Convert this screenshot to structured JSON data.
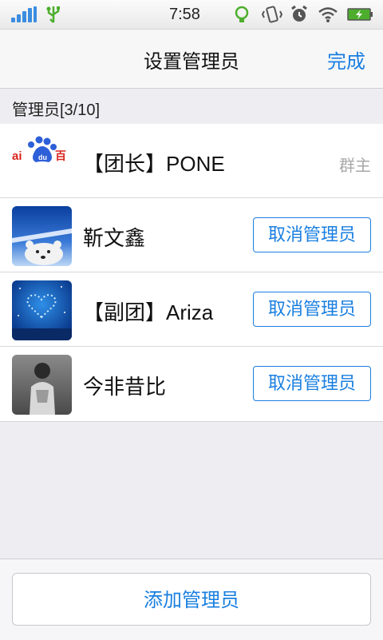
{
  "status_bar": {
    "time": "7:58",
    "icons": [
      "signal-icon",
      "usb-icon",
      "bulb-icon",
      "vibrate-icon",
      "alarm-icon",
      "wifi-icon",
      "battery-charging-icon"
    ]
  },
  "nav": {
    "title": "设置管理员",
    "done_label": "完成"
  },
  "section": {
    "header": "管理员[3/10]"
  },
  "admins": [
    {
      "name": "【团长】PONE",
      "role": "群主",
      "avatar": "baidu-logo"
    },
    {
      "name": "靳文鑫",
      "action_label": "取消管理员",
      "avatar": "polar-bear-photo"
    },
    {
      "name": "【副团】Ariza",
      "action_label": "取消管理员",
      "avatar": "heart-lights-photo"
    },
    {
      "name": "今非昔比",
      "action_label": "取消管理员",
      "avatar": "person-photo"
    }
  ],
  "footer": {
    "add_label": "添加管理员"
  },
  "colors": {
    "accent": "#1a7fe0",
    "background": "#eeeef2"
  }
}
